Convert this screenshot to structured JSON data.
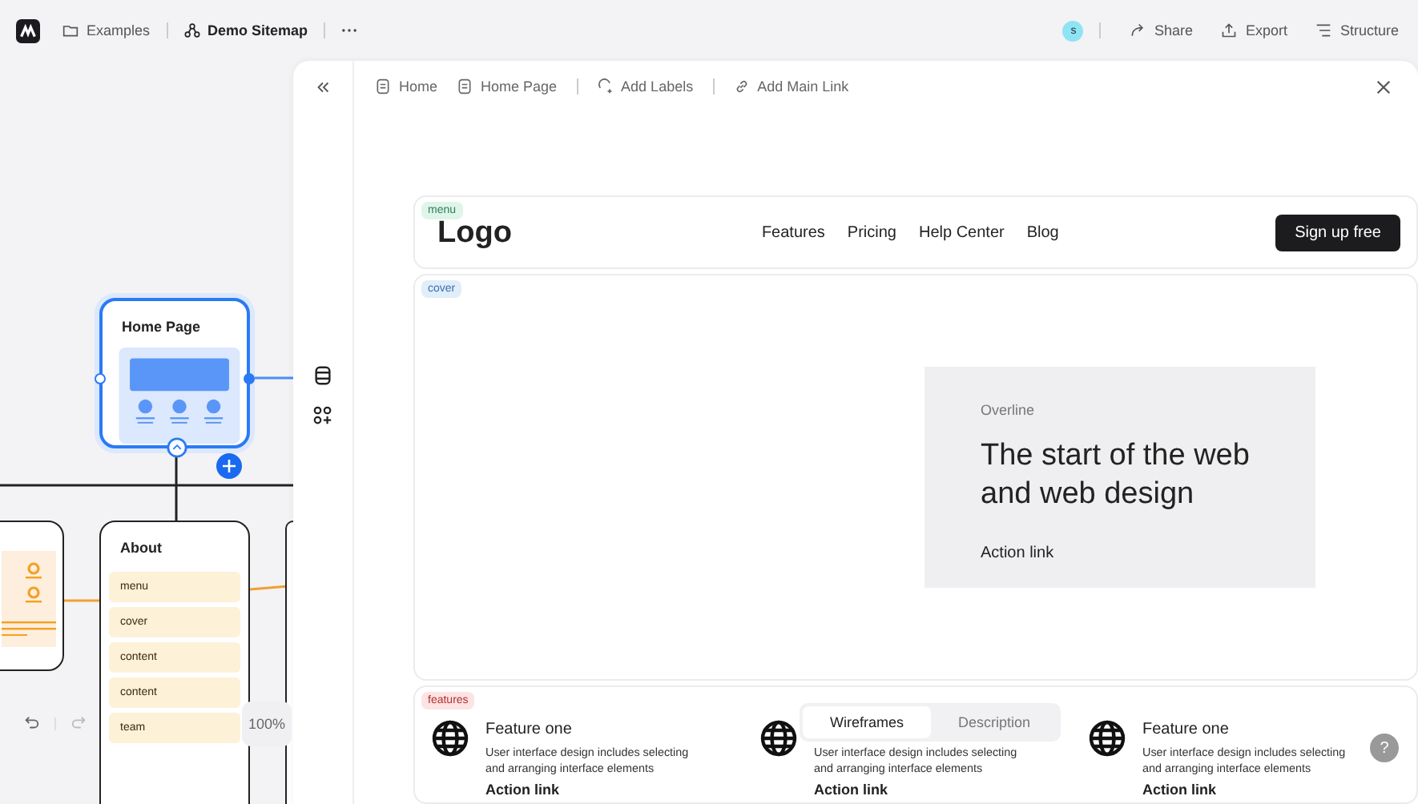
{
  "topbar": {
    "breadcrumbs": [
      {
        "label": "Examples",
        "kind": "folder"
      },
      {
        "label": "Demo Sitemap",
        "kind": "sitemap"
      }
    ],
    "avatar": "s",
    "actions": [
      {
        "label": "Share",
        "kind": "share"
      },
      {
        "label": "Export",
        "kind": "export"
      },
      {
        "label": "Structure",
        "kind": "structure"
      }
    ]
  },
  "canvas": {
    "home_node": {
      "title": "Home Page",
      "selected": true
    },
    "about_node": {
      "title": "About",
      "sections": [
        "menu",
        "cover",
        "content",
        "content",
        "team"
      ]
    },
    "zoom": "100%"
  },
  "panel": {
    "crumbs": [
      {
        "label": "Home",
        "kind": "page"
      },
      {
        "label": "Home Page",
        "kind": "page"
      },
      {
        "label": "Add Labels",
        "kind": "label"
      },
      {
        "label": "Add Main Link",
        "kind": "link"
      }
    ],
    "sections": [
      {
        "kind": "menu",
        "label": "menu",
        "color": "#2f7d55",
        "logo": "Logo",
        "links": [
          "Features",
          "Pricing",
          "Help Center",
          "Blog"
        ],
        "button": "Sign up free"
      },
      {
        "kind": "cover",
        "label": "cover",
        "color": "#3a6ea8",
        "overline": "Overline",
        "heading": "The start of the web and web design",
        "link": "Action link"
      },
      {
        "kind": "features",
        "label": "features",
        "color": "#b03030",
        "views": [
          {
            "label": "Wireframes",
            "selected": true
          },
          {
            "label": "Description",
            "selected": false
          }
        ],
        "items": [
          {
            "title": "Feature one",
            "text": "User interface design includes selecting and arranging interface elements",
            "link": "Action link"
          },
          {
            "text": "User interface design includes selecting and arranging interface elements",
            "link": "Action link"
          },
          {
            "title": "Feature one",
            "text": "User interface design includes selecting and arranging interface elements",
            "link": "Action link"
          }
        ]
      }
    ]
  },
  "help": "?"
}
